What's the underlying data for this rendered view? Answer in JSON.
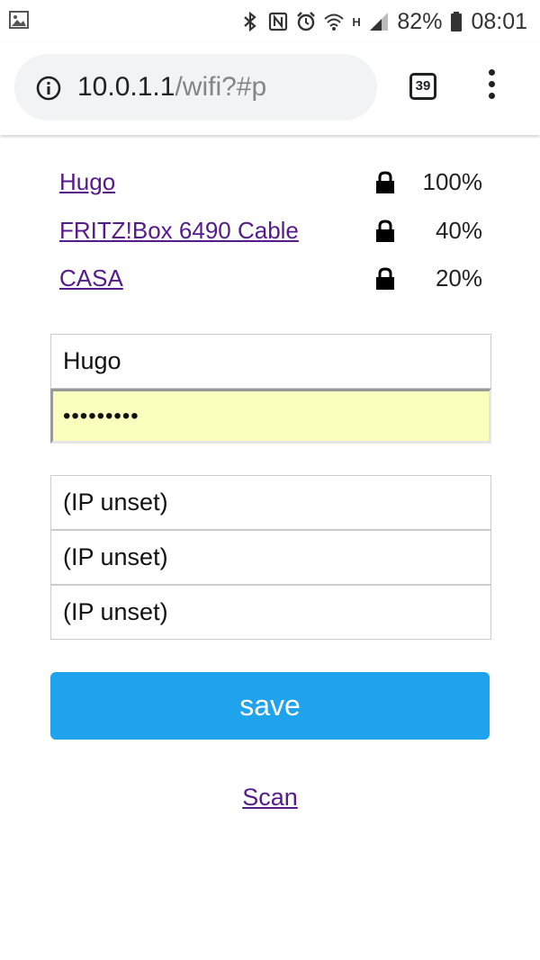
{
  "status_bar": {
    "battery": "82%",
    "time": "08:01",
    "network_type": "H",
    "icons": [
      "image-notification-icon",
      "bluetooth-icon",
      "nfc-icon",
      "alarm-icon",
      "wifi-icon",
      "signal-icon",
      "battery-icon"
    ]
  },
  "browser": {
    "url_host": "10.0.1.1",
    "url_path": "/wifi?#p",
    "tab_count": "39"
  },
  "networks": [
    {
      "ssid": "Hugo",
      "quality": "100%",
      "secured": true
    },
    {
      "ssid": "FRITZ!Box 6490 Cable",
      "quality": "40%",
      "secured": true
    },
    {
      "ssid": "CASA",
      "quality": "20%",
      "secured": true
    }
  ],
  "form": {
    "ssid_value": "Hugo",
    "password_value": "•••••••••",
    "ip_fields": [
      "(IP unset)",
      "(IP unset)",
      "(IP unset)"
    ],
    "save_label": "save"
  },
  "scan_label": "Scan",
  "colors": {
    "button": "#1fa3ec",
    "link": "#551a8b",
    "autofill": "#faffbd"
  }
}
